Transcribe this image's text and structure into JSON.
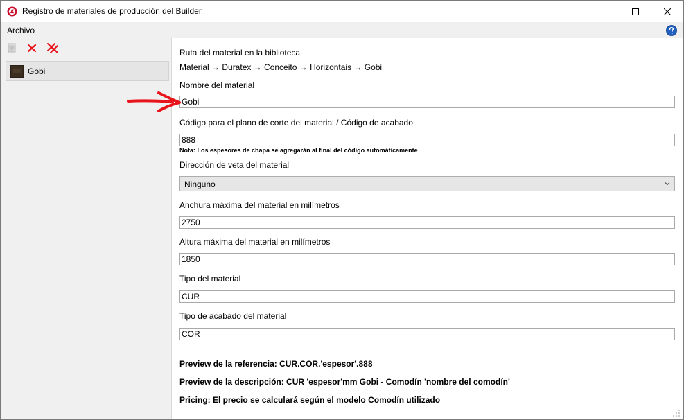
{
  "window": {
    "title": "Registro de materiales de producción del Builder",
    "minimize_symbol": "—",
    "maximize_symbol": "☐",
    "close_symbol": "✕"
  },
  "menu": {
    "file_label": "Archivo"
  },
  "toolbar": {
    "add_icon": "add-icon",
    "delete_icon": "delete-icon",
    "delete_all_icon": "delete-all-icon"
  },
  "material_list": {
    "items": [
      {
        "label": "Gobi"
      }
    ]
  },
  "form": {
    "library_path_label": "Ruta del material en la biblioteca",
    "library_path_value": "Material → Duratex → Conceito → Horizontais → Gobi",
    "name_label": "Nombre del material",
    "name_value": "Gobi",
    "code_label": "Código para el plano de corte del material / Código de acabado",
    "code_value": "888",
    "code_note": "Nota: Los espesores de chapa se agregarán al final del código automáticamente",
    "grain_label": "Dirección de veta del material",
    "grain_value": "Ninguno",
    "max_width_label": "Anchura máxima del material en milímetros",
    "max_width_value": "2750",
    "max_height_label": "Altura máxima del material en milímetros",
    "max_height_value": "1850",
    "type_label": "Tipo del material",
    "type_value": "CUR",
    "finish_type_label": "Tipo de acabado del material",
    "finish_type_value": "COR"
  },
  "preview": {
    "reference": "Preview de la referencia: CUR.COR.'espesor'.888",
    "description": "Preview de la descripción: CUR 'espesor'mm Gobi - Comodín 'nombre del comodín'",
    "pricing": "Pricing: El precio se calculará según el modelo Comodín utilizado"
  },
  "colors": {
    "accent_red": "#e8141c",
    "help_blue": "#1f5fbf",
    "panel_gray": "#f0f0f0"
  }
}
